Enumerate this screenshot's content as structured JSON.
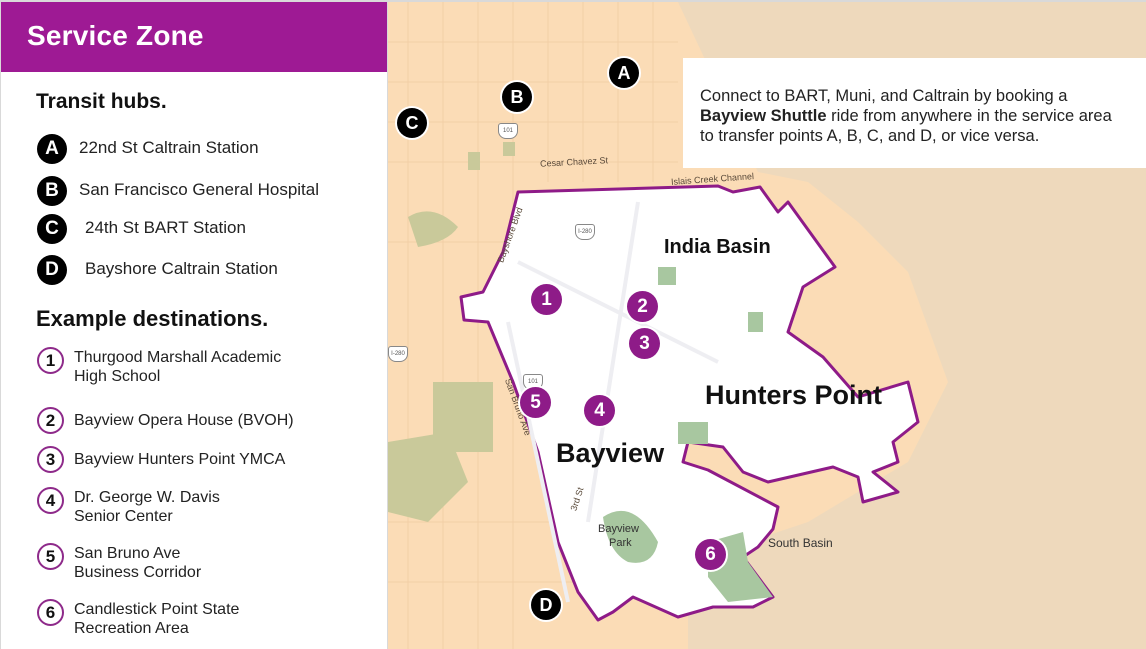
{
  "panel": {
    "title": "Service Zone",
    "hubs_title": "Transit hubs.",
    "hubs": [
      {
        "letter": "A",
        "label": "22nd St Caltrain Station"
      },
      {
        "letter": "B",
        "label": "San Francisco General Hospital"
      },
      {
        "letter": "C",
        "label": "24th St BART Station"
      },
      {
        "letter": "D",
        "label": "Bayshore Caltrain Station"
      }
    ],
    "destinations_title": "Example destinations.",
    "destinations": [
      {
        "number": "1",
        "line1": "Thurgood Marshall Academic",
        "line2": "High School"
      },
      {
        "number": "2",
        "line1": "Bayview Opera House (BVOH)",
        "line2": ""
      },
      {
        "number": "3",
        "line1": "Bayview Hunters Point YMCA",
        "line2": ""
      },
      {
        "number": "4",
        "line1": "Dr. George W. Davis",
        "line2": "Senior Center"
      },
      {
        "number": "5",
        "line1": "San Bruno Ave",
        "line2": "Business Corridor"
      },
      {
        "number": "6",
        "line1": "Candlestick Point State",
        "line2": "Recreation Area"
      }
    ]
  },
  "info": {
    "line1": "Connect to BART, Muni, and Caltrain by booking a",
    "bold": "Bayview Shuttle",
    "line2_rest": " ride from anywhere in the service area",
    "line3": "to transfer points A, B, C, and D, or vice versa."
  },
  "map": {
    "areas": [
      "India Basin",
      "Hunters Point",
      "Bayview"
    ],
    "streets": [
      "Cesar Chavez St",
      "Islais Creek Channel",
      "Bayshore Blvd",
      "San Bruno Ave",
      "3rd St",
      "South Basin",
      "Bayview",
      "Park"
    ],
    "shields": [
      "101",
      "I-280",
      "101",
      "I-280"
    ],
    "hub_markers": [
      "A",
      "B",
      "C",
      "D"
    ],
    "dest_markers": [
      "1",
      "2",
      "3",
      "4",
      "5",
      "6"
    ],
    "colors": {
      "brand_purple": "#9e1a94",
      "zone_outline": "#8e1b88",
      "land": "#fbdcb6",
      "water": "#eed9bc",
      "park": "#a8c7a0",
      "zone_fill": "#ffffff"
    }
  }
}
